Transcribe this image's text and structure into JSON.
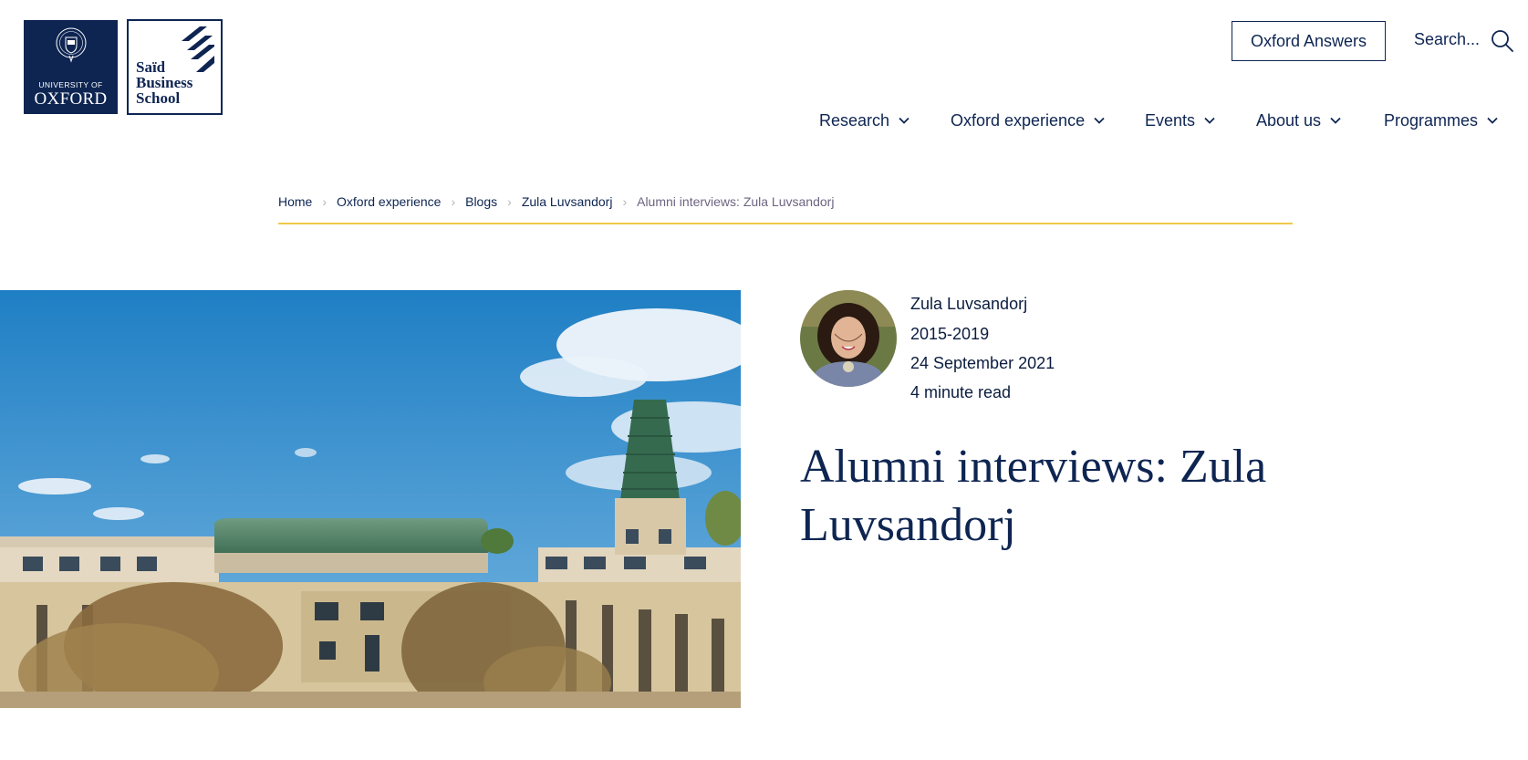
{
  "logos": {
    "oxford_small": "UNIVERSITY OF",
    "oxford_big": "OXFORD",
    "sbs_line1": "Saïd",
    "sbs_line2": "Business",
    "sbs_line3": "School"
  },
  "header": {
    "answers_button": "Oxford Answers",
    "search_label": "Search...",
    "nav": [
      {
        "label": "Research"
      },
      {
        "label": "Oxford experience"
      },
      {
        "label": "Events"
      },
      {
        "label": "About us"
      },
      {
        "label": "Programmes"
      }
    ]
  },
  "breadcrumb": [
    {
      "label": "Home"
    },
    {
      "label": "Oxford experience"
    },
    {
      "label": "Blogs"
    },
    {
      "label": "Zula Luvsandorj"
    },
    {
      "label": "Alumni interviews: Zula Luvsandorj"
    }
  ],
  "article": {
    "author": "Zula Luvsandorj",
    "years": "2015-2019",
    "date": "24 September 2021",
    "read_time": "4 minute read",
    "title": "Alumni interviews: Zula Luvsandorj"
  },
  "colors": {
    "navy": "#0e2552",
    "accent_rule": "#f0c94a"
  }
}
